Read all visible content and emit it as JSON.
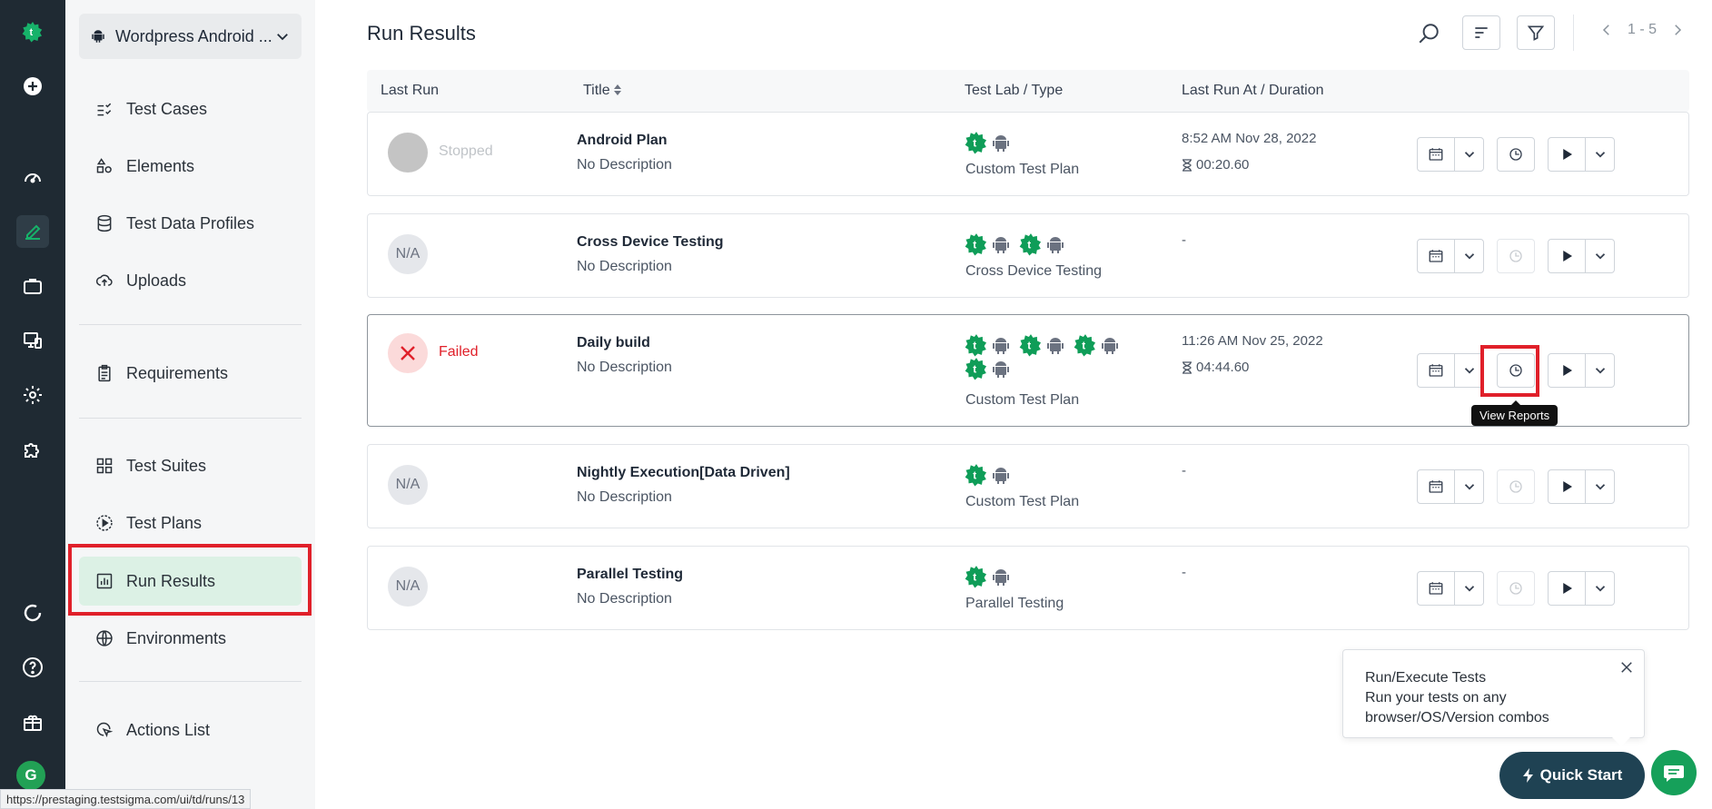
{
  "window": {
    "title": "Run Results"
  },
  "colors": {
    "brand_green": "#0f9d58",
    "rail_bg": "#1f2a33",
    "active_nav_bg": "#dcf1e5",
    "failed_red": "#e0202a",
    "highlight_red": "#e0202a",
    "quick_start_bg": "#1f4253"
  },
  "rail": {
    "items": [
      {
        "icon": "testsigma-logo-icon"
      },
      {
        "icon": "plus-circle-icon"
      },
      {
        "icon": "dashboard-gauge-icon"
      },
      {
        "icon": "pencil-edit-icon",
        "active": true
      },
      {
        "icon": "briefcase-icon"
      },
      {
        "icon": "device-monitor-icon"
      },
      {
        "icon": "gear-icon"
      },
      {
        "icon": "puzzle-addon-icon"
      },
      {
        "icon": "refresh-circle-icon"
      },
      {
        "icon": "help-question-icon"
      },
      {
        "icon": "gift-icon"
      }
    ],
    "avatar_initial": "G"
  },
  "project_selector": {
    "label": "Wordpress Android ...",
    "icon": "android-icon"
  },
  "nav": {
    "items": [
      {
        "label": "Test Cases",
        "icon": "checklist-icon"
      },
      {
        "label": "Elements",
        "icon": "shapes-icon"
      },
      {
        "label": "Test Data Profiles",
        "icon": "database-icon"
      },
      {
        "label": "Uploads",
        "icon": "cloud-upload-icon"
      },
      {
        "label": "Requirements",
        "icon": "clipboard-icon"
      },
      {
        "label": "Test Suites",
        "icon": "grid-icon"
      },
      {
        "label": "Test Plans",
        "icon": "play-circle-icon"
      },
      {
        "label": "Run Results",
        "icon": "bar-chart-icon",
        "active": true
      },
      {
        "label": "Environments",
        "icon": "globe-icon"
      },
      {
        "label": "Actions List",
        "icon": "cursor-click-icon"
      }
    ]
  },
  "toolbar": {
    "pager_text": "1 - 5"
  },
  "table": {
    "headers": {
      "last_run": "Last Run",
      "title": "Title",
      "lab_type": "Test Lab / Type",
      "last_run_at": "Last Run At / Duration"
    },
    "rows": [
      {
        "status": "Stopped",
        "status_badge": "",
        "title": "Android Plan",
        "desc": "No Description",
        "lab_type": "Custom Test Plan",
        "last_run_at": "8:52 AM Nov 28, 2022",
        "duration": "00:20.60"
      },
      {
        "status": "",
        "status_badge": "N/A",
        "title": "Cross Device Testing",
        "desc": "No Description",
        "lab_type": "Cross Device Testing",
        "last_run_at": "-",
        "duration": ""
      },
      {
        "status": "Failed",
        "status_badge": "",
        "title": "Daily build",
        "desc": "No Description",
        "lab_type": "Custom Test Plan",
        "last_run_at": "11:26 AM Nov 25, 2022",
        "duration": "04:44.60"
      },
      {
        "status": "",
        "status_badge": "N/A",
        "title": "Nightly Execution[Data Driven]",
        "desc": "No Description",
        "lab_type": "Custom Test Plan",
        "last_run_at": "-",
        "duration": ""
      },
      {
        "status": "",
        "status_badge": "N/A",
        "title": "Parallel Testing",
        "desc": "No Description",
        "lab_type": "Parallel Testing",
        "last_run_at": "-",
        "duration": ""
      }
    ]
  },
  "tooltip": {
    "text": "View Reports"
  },
  "popup": {
    "line1": "Run/Execute Tests",
    "line2": "Run your tests on any",
    "line3": "browser/OS/Version combos"
  },
  "quick_start": {
    "label": "Quick Start"
  },
  "statusbar": {
    "url": "https://prestaging.testsigma.com/ui/td/runs/13"
  }
}
